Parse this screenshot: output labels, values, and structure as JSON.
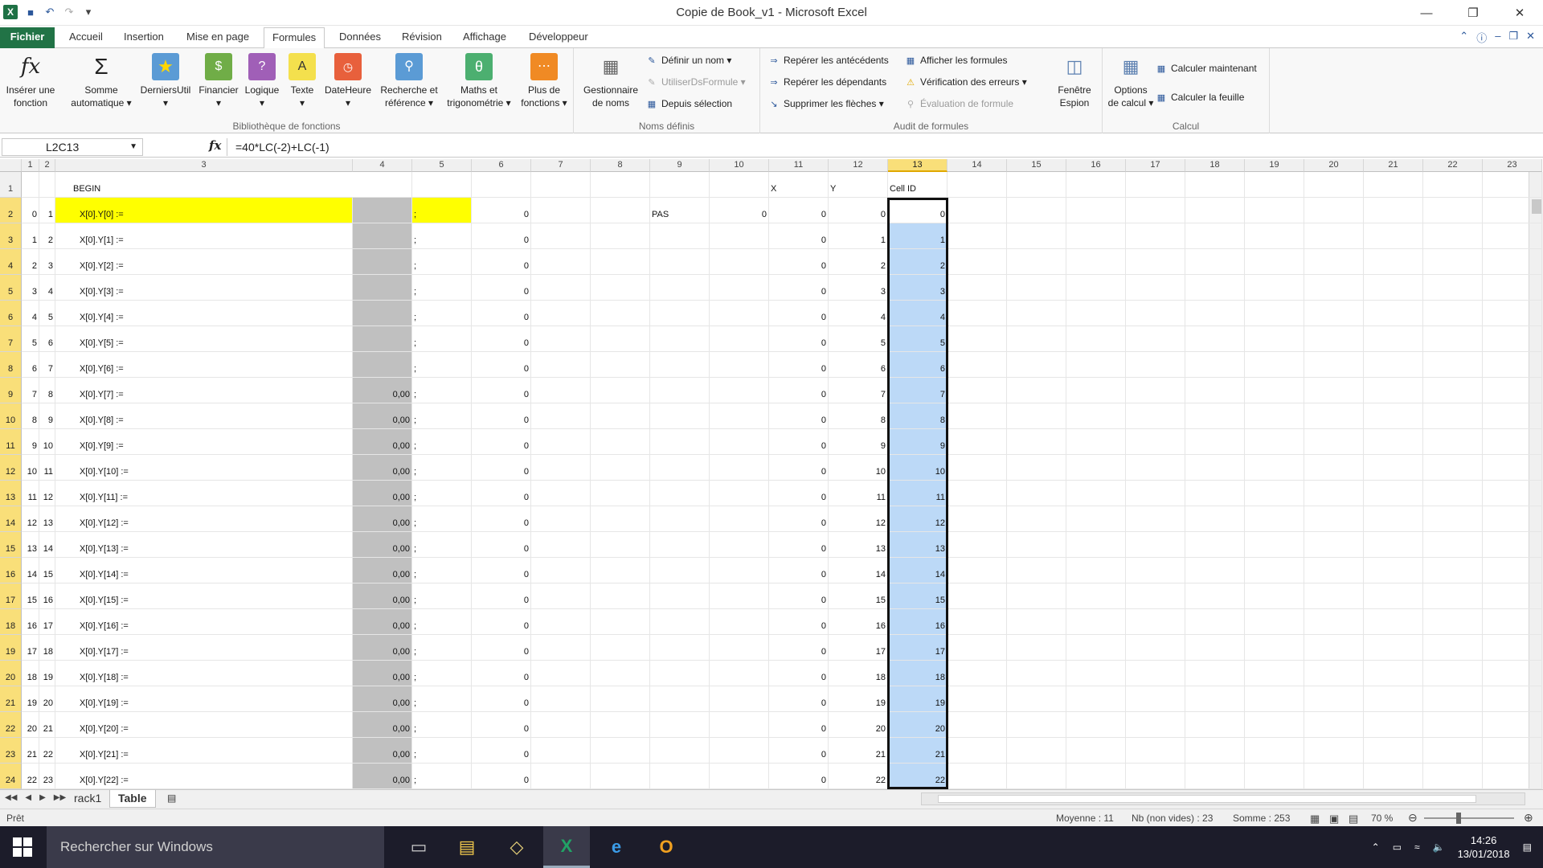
{
  "window": {
    "title": "Copie de Book_v1 - Microsoft Excel"
  },
  "tabs": [
    "Fichier",
    "Accueil",
    "Insertion",
    "Mise en page",
    "Formules",
    "Données",
    "Révision",
    "Affichage",
    "Développeur"
  ],
  "active_tab": "Formules",
  "ribbon": {
    "bibliotheque": {
      "label": "Bibliothèque de fonctions",
      "buttons": [
        {
          "l1": "Insérer une",
          "l2": "fonction",
          "icon": "fx-icon"
        },
        {
          "l1": "Somme",
          "l2": "automatique ▾",
          "icon": "sigma-icon"
        },
        {
          "l1": "DerniersUtil",
          "l2": "▾",
          "icon": "book-recent-icon"
        },
        {
          "l1": "Financier",
          "l2": "▾",
          "icon": "book-financial-icon"
        },
        {
          "l1": "Logique",
          "l2": "▾",
          "icon": "book-logic-icon"
        },
        {
          "l1": "Texte",
          "l2": "▾",
          "icon": "book-text-icon"
        },
        {
          "l1": "DateHeure",
          "l2": "▾",
          "icon": "book-datetime-icon"
        },
        {
          "l1": "Recherche et",
          "l2": "référence ▾",
          "icon": "book-lookup-icon"
        },
        {
          "l1": "Maths et",
          "l2": "trigonométrie ▾",
          "icon": "book-math-icon"
        },
        {
          "l1": "Plus de",
          "l2": "fonctions ▾",
          "icon": "book-more-icon"
        }
      ]
    },
    "noms": {
      "label": "Noms définis",
      "manager": {
        "l1": "Gestionnaire",
        "l2": "de noms"
      },
      "define": "Définir un nom ▾",
      "use": "UtiliserDsFormule ▾",
      "from_sel": "Depuis sélection"
    },
    "audit": {
      "label": "Audit de formules",
      "precedents": "Repérer les antécédents",
      "dependents": "Repérer les dépendants",
      "remove": "Supprimer les flèches ▾",
      "show": "Afficher les formules",
      "errors": "Vérification des erreurs ▾",
      "evaluate": "Évaluation de formule",
      "watch": {
        "l1": "Fenêtre",
        "l2": "Espion"
      }
    },
    "calcul": {
      "label": "Calcul",
      "options": {
        "l1": "Options",
        "l2": "de calcul ▾"
      },
      "now": "Calculer maintenant",
      "sheet": "Calculer la feuille"
    }
  },
  "formula_bar": {
    "name": "L2C13",
    "formula": "=40*LC(-2)+LC(-1)",
    "fx": "fx"
  },
  "columns": [
    "1",
    "2",
    "3",
    "4",
    "5",
    "6",
    "7",
    "8",
    "9",
    "10",
    "11",
    "12",
    "13",
    "14",
    "15",
    "16",
    "17",
    "18",
    "19",
    "20",
    "21",
    "22",
    "23"
  ],
  "selected_column": "13",
  "header_row": {
    "c3": "BEGIN",
    "c11": "X",
    "c12": "Y",
    "c13": "Cell ID"
  },
  "row2_extra": {
    "c9": "PAS",
    "c10": "0"
  },
  "rows": [
    {
      "n": "2",
      "c1": "0",
      "c2": "1",
      "c3": "X[0].Y[0] :=",
      "c4": "",
      "c5": ";",
      "c6": "0",
      "c11": "0",
      "c12": "0",
      "c13": "0"
    },
    {
      "n": "3",
      "c1": "1",
      "c2": "2",
      "c3": "X[0].Y[1] :=",
      "c4": "",
      "c5": ";",
      "c6": "0",
      "c11": "0",
      "c12": "1",
      "c13": "1"
    },
    {
      "n": "4",
      "c1": "2",
      "c2": "3",
      "c3": "X[0].Y[2] :=",
      "c4": "",
      "c5": ";",
      "c6": "0",
      "c11": "0",
      "c12": "2",
      "c13": "2"
    },
    {
      "n": "5",
      "c1": "3",
      "c2": "4",
      "c3": "X[0].Y[3] :=",
      "c4": "",
      "c5": ";",
      "c6": "0",
      "c11": "0",
      "c12": "3",
      "c13": "3"
    },
    {
      "n": "6",
      "c1": "4",
      "c2": "5",
      "c3": "X[0].Y[4] :=",
      "c4": "",
      "c5": ";",
      "c6": "0",
      "c11": "0",
      "c12": "4",
      "c13": "4"
    },
    {
      "n": "7",
      "c1": "5",
      "c2": "6",
      "c3": "X[0].Y[5] :=",
      "c4": "",
      "c5": ";",
      "c6": "0",
      "c11": "0",
      "c12": "5",
      "c13": "5"
    },
    {
      "n": "8",
      "c1": "6",
      "c2": "7",
      "c3": "X[0].Y[6] :=",
      "c4": "",
      "c5": ";",
      "c6": "0",
      "c11": "0",
      "c12": "6",
      "c13": "6"
    },
    {
      "n": "9",
      "c1": "7",
      "c2": "8",
      "c3": "X[0].Y[7] :=",
      "c4": "0,00",
      "c5": ";",
      "c6": "0",
      "c11": "0",
      "c12": "7",
      "c13": "7"
    },
    {
      "n": "10",
      "c1": "8",
      "c2": "9",
      "c3": "X[0].Y[8] :=",
      "c4": "0,00",
      "c5": ";",
      "c6": "0",
      "c11": "0",
      "c12": "8",
      "c13": "8"
    },
    {
      "n": "11",
      "c1": "9",
      "c2": "10",
      "c3": "X[0].Y[9] :=",
      "c4": "0,00",
      "c5": ";",
      "c6": "0",
      "c11": "0",
      "c12": "9",
      "c13": "9"
    },
    {
      "n": "12",
      "c1": "10",
      "c2": "11",
      "c3": "X[0].Y[10] :=",
      "c4": "0,00",
      "c5": ";",
      "c6": "0",
      "c11": "0",
      "c12": "10",
      "c13": "10"
    },
    {
      "n": "13",
      "c1": "11",
      "c2": "12",
      "c3": "X[0].Y[11] :=",
      "c4": "0,00",
      "c5": ";",
      "c6": "0",
      "c11": "0",
      "c12": "11",
      "c13": "11"
    },
    {
      "n": "14",
      "c1": "12",
      "c2": "13",
      "c3": "X[0].Y[12] :=",
      "c4": "0,00",
      "c5": ";",
      "c6": "0",
      "c11": "0",
      "c12": "12",
      "c13": "12"
    },
    {
      "n": "15",
      "c1": "13",
      "c2": "14",
      "c3": "X[0].Y[13] :=",
      "c4": "0,00",
      "c5": ";",
      "c6": "0",
      "c11": "0",
      "c12": "13",
      "c13": "13"
    },
    {
      "n": "16",
      "c1": "14",
      "c2": "15",
      "c3": "X[0].Y[14] :=",
      "c4": "0,00",
      "c5": ";",
      "c6": "0",
      "c11": "0",
      "c12": "14",
      "c13": "14"
    },
    {
      "n": "17",
      "c1": "15",
      "c2": "16",
      "c3": "X[0].Y[15] :=",
      "c4": "0,00",
      "c5": ";",
      "c6": "0",
      "c11": "0",
      "c12": "15",
      "c13": "15"
    },
    {
      "n": "18",
      "c1": "16",
      "c2": "17",
      "c3": "X[0].Y[16] :=",
      "c4": "0,00",
      "c5": ";",
      "c6": "0",
      "c11": "0",
      "c12": "16",
      "c13": "16"
    },
    {
      "n": "19",
      "c1": "17",
      "c2": "18",
      "c3": "X[0].Y[17] :=",
      "c4": "0,00",
      "c5": ";",
      "c6": "0",
      "c11": "0",
      "c12": "17",
      "c13": "17"
    },
    {
      "n": "20",
      "c1": "18",
      "c2": "19",
      "c3": "X[0].Y[18] :=",
      "c4": "0,00",
      "c5": ";",
      "c6": "0",
      "c11": "0",
      "c12": "18",
      "c13": "18"
    },
    {
      "n": "21",
      "c1": "19",
      "c2": "20",
      "c3": "X[0].Y[19] :=",
      "c4": "0,00",
      "c5": ";",
      "c6": "0",
      "c11": "0",
      "c12": "19",
      "c13": "19"
    },
    {
      "n": "22",
      "c1": "20",
      "c2": "21",
      "c3": "X[0].Y[20] :=",
      "c4": "0,00",
      "c5": ";",
      "c6": "0",
      "c11": "0",
      "c12": "20",
      "c13": "20"
    },
    {
      "n": "23",
      "c1": "21",
      "c2": "22",
      "c3": "X[0].Y[21] :=",
      "c4": "0,00",
      "c5": ";",
      "c6": "0",
      "c11": "0",
      "c12": "21",
      "c13": "21"
    },
    {
      "n": "24",
      "c1": "22",
      "c2": "23",
      "c3": "X[0].Y[22] :=",
      "c4": "0,00",
      "c5": ";",
      "c6": "0",
      "c11": "0",
      "c12": "22",
      "c13": "22"
    }
  ],
  "sheets": [
    "rack1",
    "Table"
  ],
  "active_sheet": "Table",
  "status": {
    "ready": "Prêt",
    "avg": "Moyenne : 11",
    "count": "Nb (non vides) : 23",
    "sum": "Somme : 253",
    "zoom": "70 %"
  },
  "taskbar": {
    "search": "Rechercher sur Windows",
    "time": "14:26",
    "date": "13/01/2018"
  },
  "colors": {
    "excel_green": "#217346",
    "yellow": "#ffff00",
    "gray_col": "#c0c0c0",
    "selection": "#bcd9f7"
  }
}
